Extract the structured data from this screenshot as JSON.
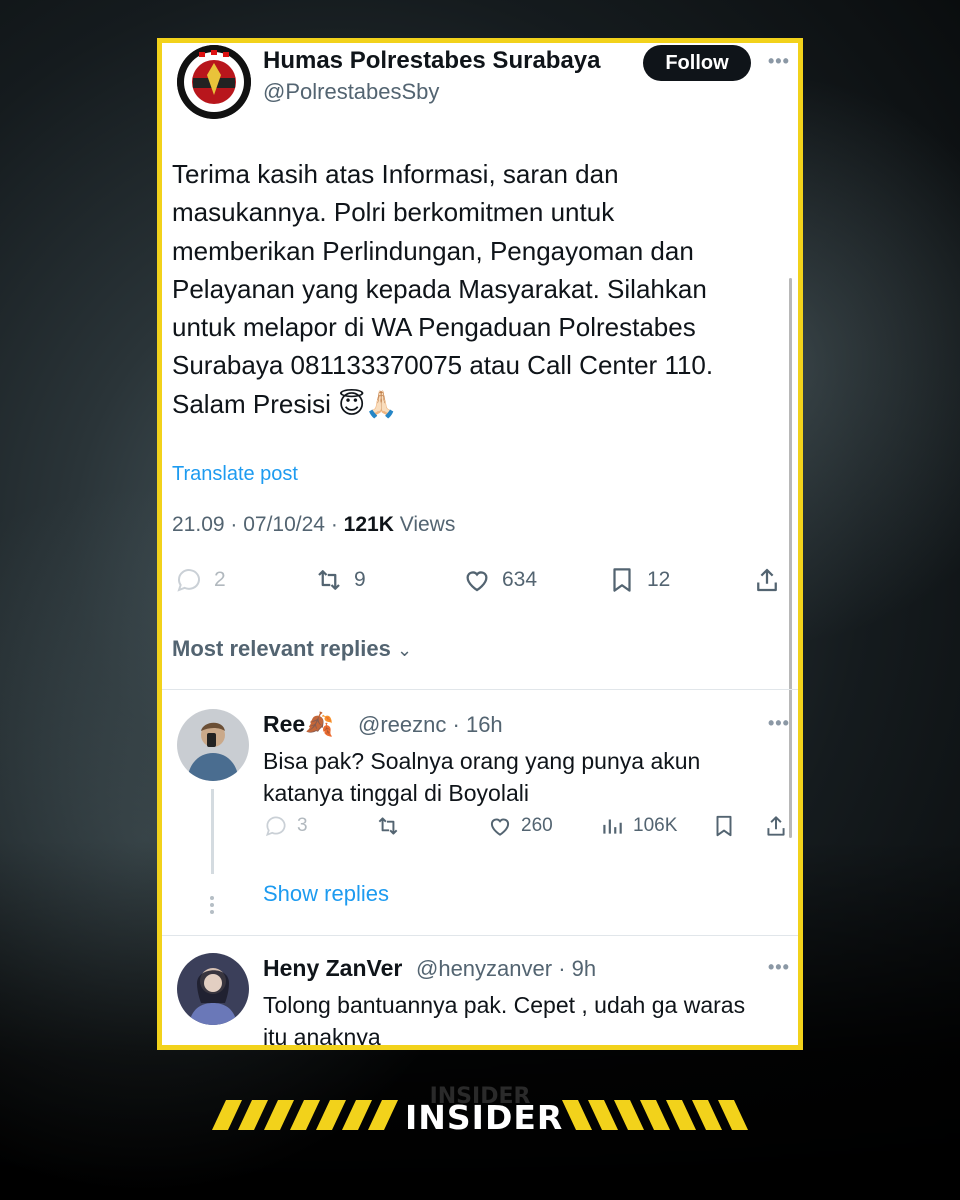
{
  "post": {
    "author_name": "Humas Polrestabes Surabaya",
    "author_handle": "@PolrestabesSby",
    "follow_label": "Follow",
    "body_lines": [
      "Terima kasih atas Informasi, saran dan",
      "masukannya. Polri berkomitmen untuk",
      "memberikan Perlindungan, Pengayoman dan",
      "Pelayanan yang kepada Masyarakat. Silahkan",
      "untuk melapor di WA Pengaduan Polrestabes",
      "Surabaya 081133370075 atau Call Center 110.",
      "Salam Presisi 😇🙏🏻"
    ],
    "translate_label": "Translate post",
    "time": "21.09",
    "date": "07/10/24",
    "views_count": "121K",
    "views_label": "Views",
    "replies": "2",
    "reposts": "9",
    "likes": "634",
    "bookmarks": "12"
  },
  "sort_label": "Most relevant replies",
  "replies": [
    {
      "name": "Ree🍂",
      "handle": "@reeznc",
      "age": "16h",
      "text_lines": [
        "Bisa pak? Soalnya orang yang punya akun",
        "katanya tinggal di Boyolali"
      ],
      "replies": "3",
      "likes": "260",
      "views": "106K",
      "show_replies_label": "Show replies"
    },
    {
      "name": "Heny ZanVer",
      "handle": "@henyzanver",
      "age": "9h",
      "text_lines": [
        "Tolong bantuannya pak. Cepet , udah ga waras",
        "itu anaknya"
      ]
    }
  ],
  "brand": {
    "name": "INSIDER",
    "accent": "#f2d21b"
  },
  "colors": {
    "link": "#1d9bf0",
    "muted": "#536471",
    "text": "#0f1419",
    "frame": "#f2d21b"
  }
}
